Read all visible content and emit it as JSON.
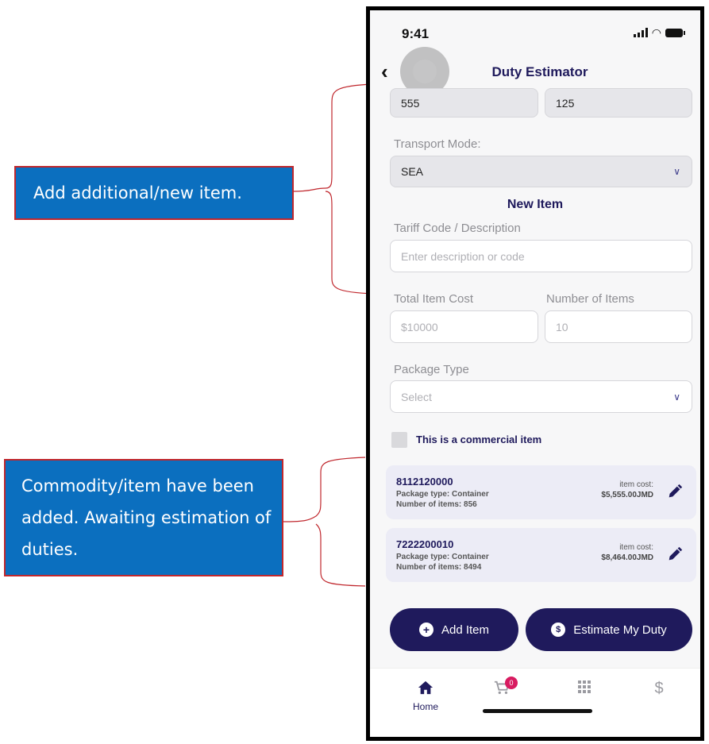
{
  "annotations": {
    "new_item": "Add additional/new item.",
    "added_items": "Commodity/item have been added. Awaiting estimation of duties."
  },
  "status_bar": {
    "time": "9:41"
  },
  "header": {
    "title": "Duty Estimator",
    "back_icon": "chevron-left"
  },
  "top_fields": {
    "left_value": "555",
    "right_value": "125"
  },
  "transport": {
    "label": "Transport Mode:",
    "value": "SEA"
  },
  "new_item": {
    "title": "New Item",
    "tariff_label": "Tariff Code / Description",
    "tariff_placeholder": "Enter description or code",
    "cost_label": "Total Item Cost",
    "cost_placeholder": "$10000",
    "count_label": "Number of Items",
    "count_placeholder": "10",
    "package_label": "Package Type",
    "package_placeholder": "Select",
    "commercial_label": "This is a commercial item"
  },
  "items": [
    {
      "code": "8112120000",
      "package": "Package type: Container",
      "count": "Number of items: 856",
      "cost_label": "item cost:",
      "cost": "$5,555.00JMD"
    },
    {
      "code": "7222200010",
      "package": "Package type: Container",
      "count": "Number of items: 8494",
      "cost_label": "item cost:",
      "cost": "$8,464.00JMD"
    }
  ],
  "actions": {
    "add_item": "Add Item",
    "estimate": "Estimate My Duty"
  },
  "tabbar": {
    "home": "Home",
    "cart_badge": "0",
    "icons": [
      "home-icon",
      "cart-icon",
      "grid-icon",
      "dollar-icon"
    ]
  },
  "colors": {
    "primary": "#1f1a5c",
    "callout": "#0b6fbf",
    "callout_border": "#c0272d",
    "badge": "#d81b60"
  }
}
